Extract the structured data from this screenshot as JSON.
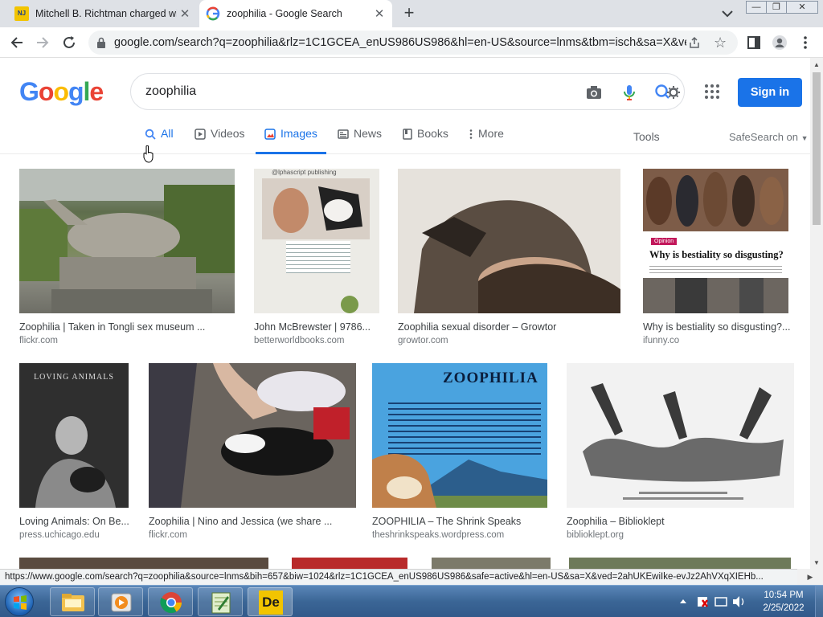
{
  "browser": {
    "tabs": [
      {
        "title": "Mitchell B. Richtman charged wit",
        "favicon_text": "NJ",
        "active": false
      },
      {
        "title": "zoophilia - Google Search",
        "active": true
      }
    ],
    "new_tab": "+",
    "url": "google.com/search?q=zoophilia&rlz=1C1GCEA_enUS986US986&hl=en-US&source=lnms&tbm=isch&sa=X&ve...",
    "status_url": "https://www.google.com/search?q=zoophilia&source=lnms&bih=657&biw=1024&rlz=1C1GCEA_enUS986US986&safe=active&hl=en-US&sa=X&ved=2ahUKEwiIke-evJz2AhVXqXIEHb..."
  },
  "google": {
    "logo": [
      "G",
      "o",
      "o",
      "g",
      "l",
      "e"
    ],
    "logo_colors": [
      "#4285f4",
      "#ea4335",
      "#fbbc05",
      "#4285f4",
      "#34a853",
      "#ea4335"
    ],
    "query": "zoophilia",
    "sign_in": "Sign in",
    "tabs": [
      {
        "label": "All",
        "icon": "search-icon"
      },
      {
        "label": "Videos",
        "icon": "video-icon"
      },
      {
        "label": "Images",
        "icon": "image-icon",
        "selected": true
      },
      {
        "label": "News",
        "icon": "news-icon"
      },
      {
        "label": "Books",
        "icon": "book-icon"
      },
      {
        "label": "More",
        "icon": "more-vert-icon"
      }
    ],
    "tools": "Tools",
    "safesearch": "SafeSearch on"
  },
  "results": [
    {
      "caption": "Zoophilia | Taken in Tongli sex museum ...",
      "source": "flickr.com",
      "color": "#6f7a5a"
    },
    {
      "caption": "John McBrewster | 9786...",
      "source": "betterworldbooks.com",
      "color": "#e9e6df",
      "overlay": "@lphascript publishing"
    },
    {
      "caption": "Zoophilia sexual disorder – Growtor",
      "source": "growtor.com",
      "color": "#8a7f74"
    },
    {
      "caption": "Why is bestiality so disgusting?...",
      "source": "ifunny.co",
      "color": "#8c7566",
      "badge": "Opinion",
      "overlay": "Why is bestiality so disgusting?"
    },
    {
      "caption": "Loving Animals: On Be...",
      "source": "press.uchicago.edu",
      "color": "#3a3a3a",
      "overlay": "LOVING ANIMALS"
    },
    {
      "caption": "Zoophilia | Nino and Jessica (we share ...",
      "source": "flickr.com",
      "color": "#4a4540"
    },
    {
      "caption": "ZOOPHILIA – The Shrink Speaks",
      "source": "theshrinkspeaks.wordpress.com",
      "color": "#4aa3df",
      "overlay": "ZOOPHILIA"
    },
    {
      "caption": "Zoophilia – Biblioklept",
      "source": "biblioklept.org",
      "color": "#f2f2f2"
    }
  ],
  "taskbar": {
    "time": "10:54 PM",
    "date": "2/25/2022",
    "apps": [
      "file-explorer-icon",
      "media-player-icon",
      "chrome-icon",
      "notepad-icon",
      "app-de-icon"
    ],
    "app_de_label": "De"
  }
}
